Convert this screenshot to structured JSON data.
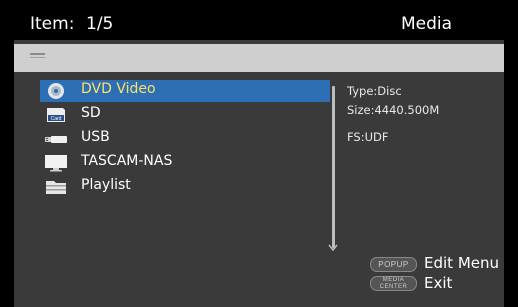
{
  "header": {
    "item_label": "Item:",
    "item_count": "1/5",
    "title": "Media"
  },
  "pathbar": {
    "icon": "folder-up-icon"
  },
  "media_list": {
    "items": [
      {
        "label": "DVD Video",
        "icon": "disc-icon",
        "selected": true
      },
      {
        "label": "SD",
        "icon": "sd-card-icon",
        "selected": false
      },
      {
        "label": "USB",
        "icon": "usb-drive-icon",
        "selected": false
      },
      {
        "label": "TASCAM-NAS",
        "icon": "network-storage-icon",
        "selected": false
      },
      {
        "label": "Playlist",
        "icon": "playlist-icon",
        "selected": false
      }
    ]
  },
  "info_panel": {
    "type": "Type:Disc",
    "size": "Size:4440.500M",
    "fs": "FS:UDF"
  },
  "softkeys": {
    "popup_key": "POPUP",
    "popup_action": "Edit Menu",
    "media_key_line1": "MEDIA",
    "media_key_line2": "CENTER",
    "media_action": "Exit"
  },
  "colors": {
    "selection": "#2c6fb5",
    "selected_text": "#ffe066",
    "panel_bg": "#3a3a3a",
    "header_bg": "#000000",
    "pathbar_bg": "#cfcfcf"
  }
}
